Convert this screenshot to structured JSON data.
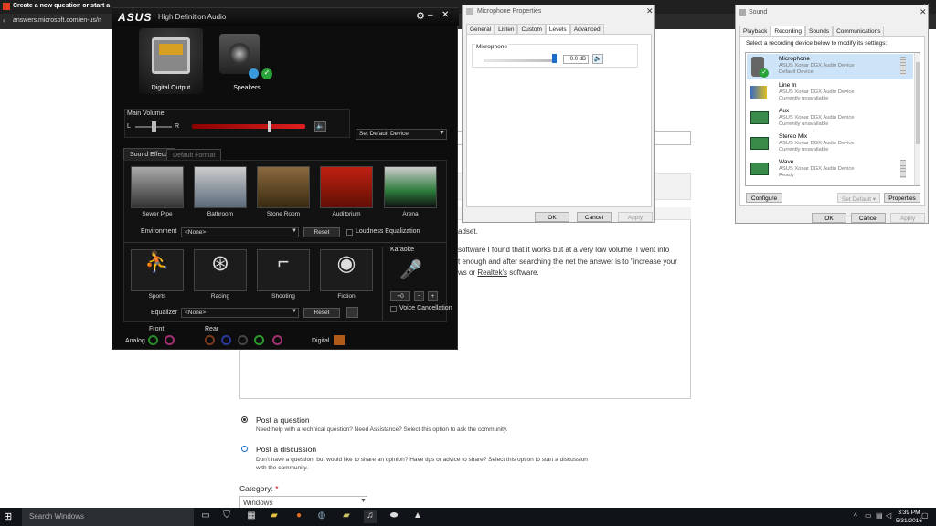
{
  "browser": {
    "tab_title": "Create a new question or start a d...",
    "url": "answers.microsoft.com/en-us/n"
  },
  "page": {
    "text_line1": "adset.",
    "text_line2": "software I found that it works but at a very low volume. I went into",
    "text_line3": "t enough and after searching the net the answer is to \"increase your",
    "text_line4a": "ws or ",
    "text_line4b": "Realtek's",
    "text_line4c": " software.",
    "post_question": {
      "title": "Post a question",
      "desc": "Need help with a technical question? Need Assistance? Select this option to ask the community."
    },
    "post_discussion": {
      "title": "Post a discussion",
      "desc1": "Don't have a question, but would like to share an opinion? Have tips or advice to share? Select this option to start a discussion",
      "desc2": "with the community."
    },
    "category_label": "Category:",
    "category_required": "*",
    "category_value": "Windows"
  },
  "asus": {
    "brand": "ASUS",
    "title": "High Definition Audio",
    "devices": [
      {
        "label": "Digital Output"
      },
      {
        "label": "Speakers"
      }
    ],
    "main_volume": "Main Volume",
    "left": "L",
    "right": "R",
    "volume_level": 0.66,
    "default_device_select": "Set Default Device",
    "tabs": [
      "Sound Effects",
      "Default Format"
    ],
    "effects": [
      "Sewer Pipe",
      "Bathroom",
      "Stone Room",
      "Auditorium",
      "Arena"
    ],
    "environment_label": "Environment",
    "environment_value": "<None>",
    "reset_label": "Reset",
    "loudness_label": "Loudness Equalization",
    "karaoke_label": "Karaoke",
    "presets": [
      "Sports",
      "Racing",
      "Shooting",
      "Fiction"
    ],
    "karaoke_value": "+0",
    "minus": "−",
    "plus": "+",
    "voice_cancel_label": "Voice Cancellation",
    "equalizer_label": "Equalizer",
    "equalizer_value": "<None>",
    "front_label": "Front",
    "rear_label": "Rear",
    "analog_label": "Analog",
    "digital_label": "Digital"
  },
  "mic_props": {
    "title": "Microphone Properties",
    "tabs": [
      "General",
      "Listen",
      "Custom",
      "Levels",
      "Advanced"
    ],
    "group_label": "Microphone",
    "level_value": "0.0 dB",
    "level_fraction": 1.0,
    "ok": "OK",
    "cancel": "Cancel",
    "apply": "Apply"
  },
  "sound": {
    "title": "Sound",
    "tabs": [
      "Playback",
      "Recording",
      "Sounds",
      "Communications"
    ],
    "instruction": "Select a recording device below to modify its settings:",
    "devices": [
      {
        "name": "Microphone",
        "driver": "ASUS Xonar DGX Audio Device",
        "status": "Default Device"
      },
      {
        "name": "Line In",
        "driver": "ASUS Xonar DGX Audio Device",
        "status": "Currently unavailable"
      },
      {
        "name": "Aux",
        "driver": "ASUS Xonar DGX Audio Device",
        "status": "Currently unavailable"
      },
      {
        "name": "Stereo Mix",
        "driver": "ASUS Xonar DGX Audio Device",
        "status": "Currently unavailable"
      },
      {
        "name": "Wave",
        "driver": "ASUS Xonar DGX Audio Device",
        "status": "Ready"
      }
    ],
    "configure": "Configure",
    "set_default": "Set Default",
    "properties": "Properties",
    "ok": "OK",
    "cancel": "Cancel",
    "apply": "Apply"
  },
  "taskbar": {
    "search_placeholder": "Search Windows",
    "time": "3:39 PM",
    "date": "5/31/2016"
  },
  "colors": {
    "asus_red": "#e02020",
    "link_blue": "#1a6ec6",
    "taskbar": "#101418"
  }
}
